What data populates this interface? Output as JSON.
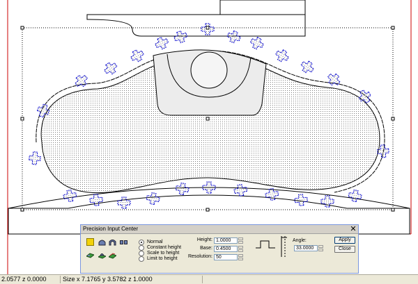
{
  "canvas": {
    "colors": {
      "outline": "#000000",
      "selection_dots": "#000000",
      "teeth": "#0000cc",
      "redline": "#cc0000",
      "background": "#ffffff"
    }
  },
  "dialog": {
    "title": "Precision Input Center",
    "close_glyph": "✕",
    "toolbar": {
      "tools": [
        {
          "icon": "yellow-square-icon",
          "color": "#f2d20a"
        },
        {
          "icon": "dome-shape-icon"
        },
        {
          "icon": "arch-shape-icon"
        },
        {
          "icon": "two-square-shape-icon"
        },
        {
          "icon": "green-plate-icon",
          "color": "#3c9a3c"
        },
        {
          "icon": "green-dome-plate-icon",
          "color": "#3c9a3c"
        },
        {
          "icon": "green-sheet-icon",
          "color": "#3c9a3c"
        }
      ]
    },
    "mode": {
      "options": [
        "Normal",
        "Constant height",
        "Scale to height",
        "Limit to height"
      ],
      "selected": "Normal"
    },
    "fields": {
      "height": {
        "label": "Height:",
        "value": "1.0000"
      },
      "base": {
        "label": "Base:",
        "value": "0.4500"
      },
      "resolution": {
        "label": "Resolution:",
        "value": "50"
      },
      "angle": {
        "label": "Angle:",
        "value": "33.0000"
      }
    },
    "buttons": {
      "apply": "Apply",
      "close": "Close"
    }
  },
  "status": {
    "coordinate": "2.0577 z 0.0000",
    "size": "Size x 7.1765 y 3.5782 z 1.0000"
  }
}
